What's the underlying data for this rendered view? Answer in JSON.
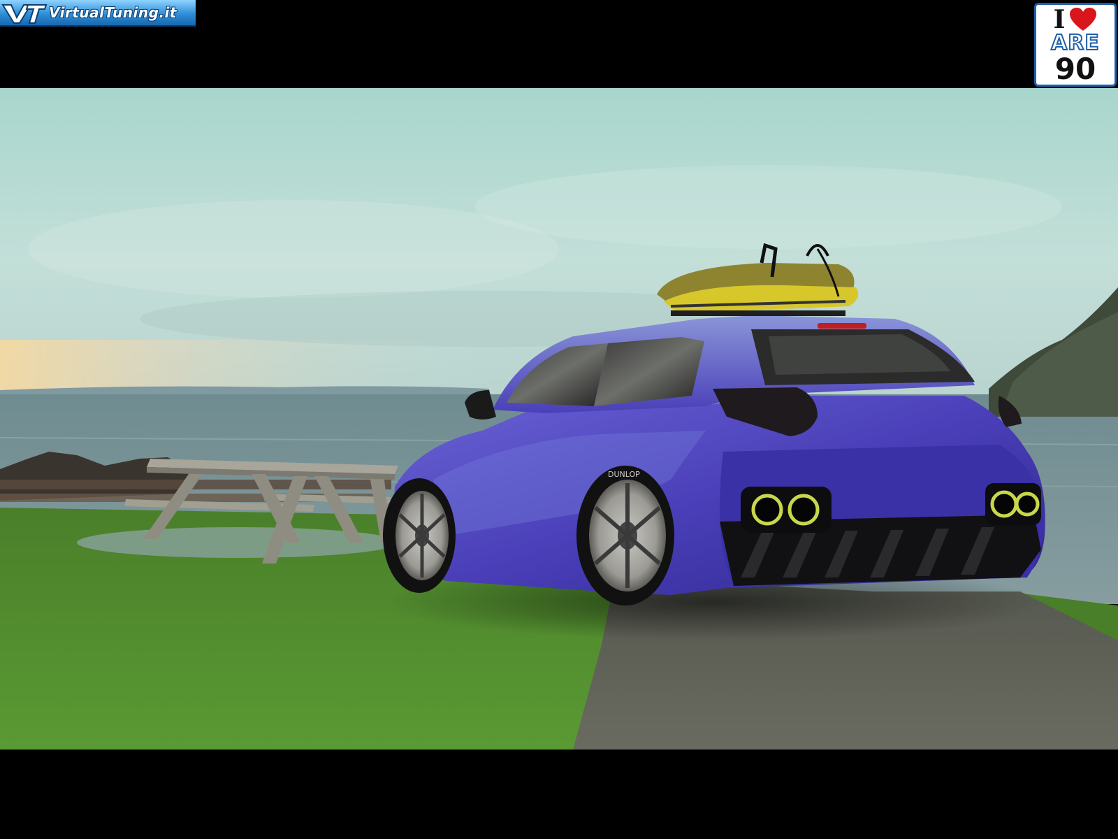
{
  "site_logo": {
    "text": "VirtualTuning.it",
    "colors": {
      "top": "#8fd3ff",
      "bottom": "#1767b0",
      "outline": "#0b3f75"
    }
  },
  "badge": {
    "line1": "I",
    "heart_icon": "heart-icon",
    "line2": "ARE",
    "line3": "90",
    "colors": {
      "border": "#1f5fa8",
      "heart": "#d8161b"
    }
  },
  "scene": {
    "car_color": "#4a3fb8",
    "sky_color": "#a9cfc7",
    "sea_color": "#5f7f86",
    "grass_color": "#4f8a2c",
    "tire_brand": "DUNLOP"
  }
}
